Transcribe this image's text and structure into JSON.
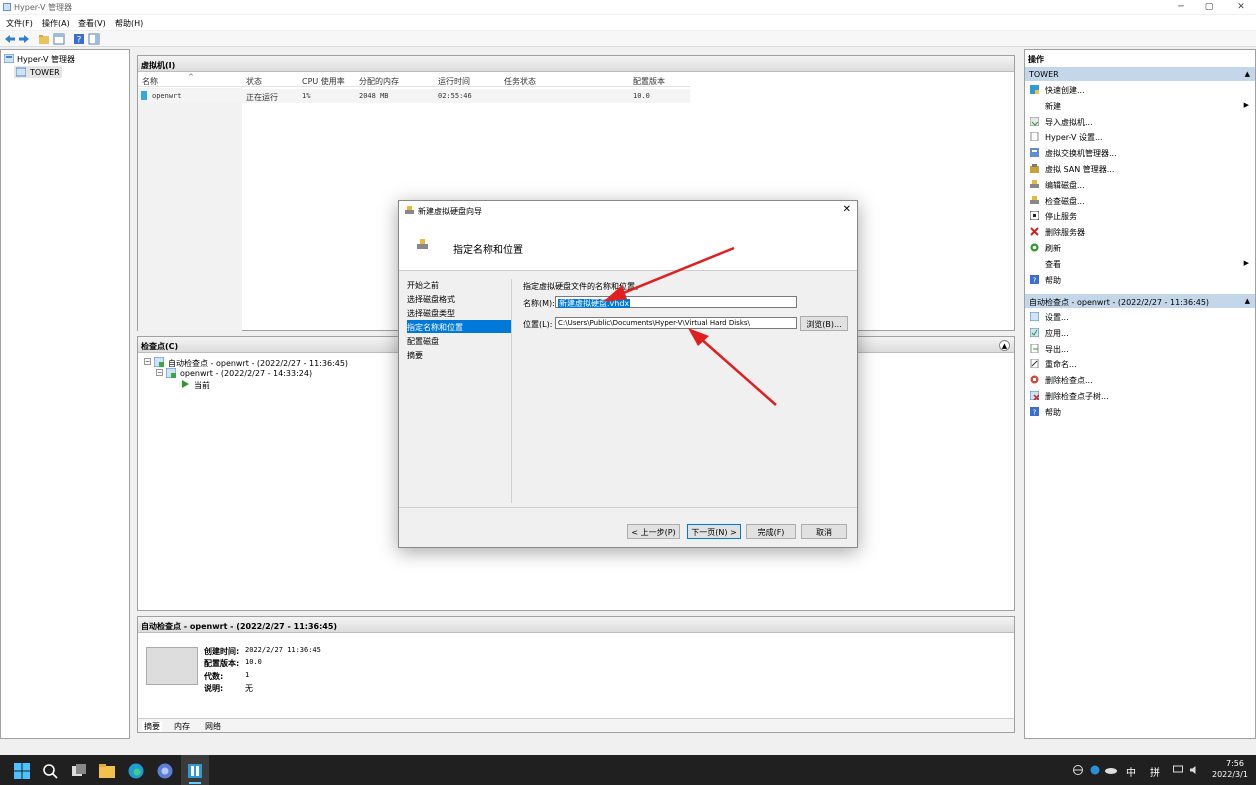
{
  "window": {
    "title": "Hyper-V 管理器",
    "minimize": "─",
    "maximize": "▢",
    "close": "✕"
  },
  "menu": [
    "文件(F)",
    "操作(A)",
    "查看(V)",
    "帮助(H)"
  ],
  "tree": {
    "root": "Hyper-V 管理器",
    "server": "TOWER"
  },
  "vms": {
    "header": "虚拟机(I)",
    "sort_glyph": "^",
    "columns": [
      "名称",
      "状态",
      "CPU 使用率",
      "分配的内存",
      "运行时间",
      "任务状态",
      "配置版本"
    ],
    "rows": [
      {
        "name": "openwrt",
        "state": "正在运行",
        "cpu": "1%",
        "mem": "2048 MB",
        "uptime": "02:55:46",
        "task": "",
        "ver": "10.0"
      }
    ]
  },
  "checkpoints": {
    "header": "检查点(C)",
    "items": [
      "自动检查点 - openwrt - (2022/2/27 - 11:36:45)",
      "openwrt - (2022/2/27 - 14:33:24)",
      "当前"
    ]
  },
  "details": {
    "header": "自动检查点 - openwrt - (2022/2/27 - 11:36:45)",
    "created_label": "创建时间:",
    "created": "2022/2/27 11:36:45",
    "ver_label": "配置版本:",
    "ver": "10.0",
    "gen_label": "代数:",
    "gen": "1",
    "note_label": "说明:",
    "note": "无",
    "tabs": [
      "摘要",
      "内存",
      "网络"
    ]
  },
  "actions": {
    "header": "操作",
    "tower_section": "TOWER",
    "tower_items": [
      {
        "label": "快速创建...",
        "icon": "quick-create-icon"
      },
      {
        "label": "新建",
        "icon": "none",
        "arrow": "▶"
      },
      {
        "label": "导入虚拟机...",
        "icon": "import-icon"
      },
      {
        "label": "Hyper-V 设置...",
        "icon": "settings-doc-icon"
      },
      {
        "label": "虚拟交换机管理器...",
        "icon": "switch-icon"
      },
      {
        "label": "虚拟 SAN 管理器...",
        "icon": "san-icon"
      },
      {
        "label": "编辑磁盘...",
        "icon": "disk-icon"
      },
      {
        "label": "检查磁盘...",
        "icon": "disk-icon"
      },
      {
        "label": "停止服务",
        "icon": "stop-icon"
      },
      {
        "label": "删除服务器",
        "icon": "delete-icon"
      },
      {
        "label": "刷新",
        "icon": "refresh-icon"
      },
      {
        "label": "查看",
        "icon": "none",
        "arrow": "▶"
      },
      {
        "label": "帮助",
        "icon": "help-icon"
      }
    ],
    "cp_section": "自动检查点 - openwrt - (2022/2/27 - 11:36:45)",
    "cp_items": [
      {
        "label": "设置...",
        "icon": "settings-icon"
      },
      {
        "label": "应用...",
        "icon": "apply-icon"
      },
      {
        "label": "导出...",
        "icon": "export-icon"
      },
      {
        "label": "重命名...",
        "icon": "rename-icon"
      },
      {
        "label": "删除检查点...",
        "icon": "delete-checkpoint-icon"
      },
      {
        "label": "删除检查点子树...",
        "icon": "delete-subtree-icon"
      },
      {
        "label": "帮助",
        "icon": "help-icon"
      }
    ]
  },
  "dialog": {
    "title": "新建虚拟硬盘向导",
    "heading": "指定名称和位置",
    "nav": [
      "开始之前",
      "选择磁盘格式",
      "选择磁盘类型",
      "指定名称和位置",
      "配置磁盘",
      "摘要"
    ],
    "active_nav": 3,
    "instruction": "指定虚拟硬盘文件的名称和位置。",
    "name_label": "名称(M):",
    "name_value": "新建虚拟硬盘.vhdx",
    "loc_label": "位置(L):",
    "loc_value": "C:\\Users\\Public\\Documents\\Hyper-V\\Virtual Hard Disks\\",
    "browse": "浏览(B)...",
    "prev": "< 上一步(P)",
    "next": "下一页(N) >",
    "finish": "完成(F)",
    "cancel": "取消",
    "close": "✕"
  },
  "taskbar": {
    "ime": "中",
    "ime2": "拼",
    "time": "7:56",
    "date": "2022/3/1"
  },
  "colors": {
    "accent": "#0078d7",
    "selection": "#c4d7ea",
    "arrow": "#e02020"
  }
}
